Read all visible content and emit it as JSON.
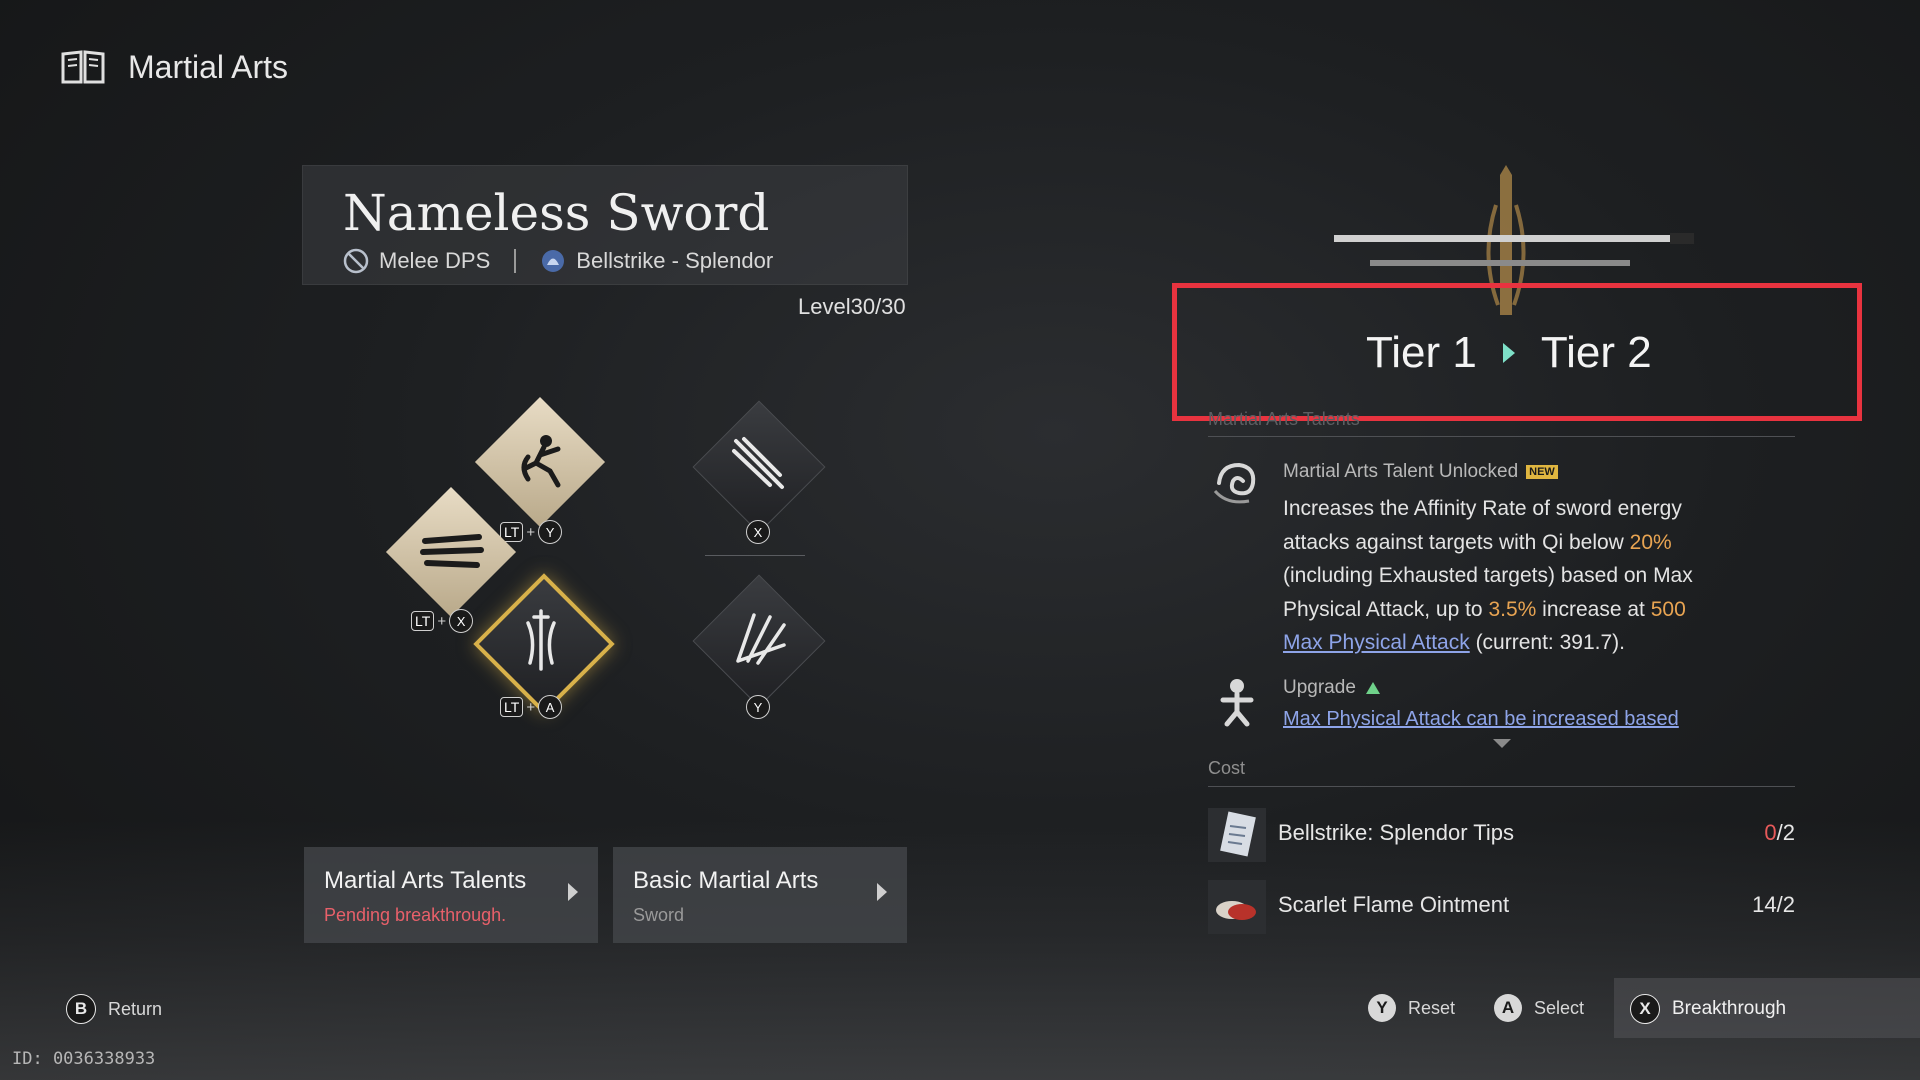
{
  "header": {
    "title": "Martial Arts",
    "icon": "book-icon"
  },
  "weapon": {
    "name": "Nameless Sword",
    "role_icon": "slash-circle-icon",
    "role": "Melee DPS",
    "path_icon": "bell-icon",
    "path": "Bellstrike - Splendor",
    "level_text": "Level30/30"
  },
  "skills": [
    {
      "icon": "kick-figure-icon",
      "hint": [
        "LT",
        "+",
        "Y"
      ]
    },
    {
      "icon": "triple-slash-icon",
      "hint": [
        "LT",
        "+",
        "X"
      ]
    },
    {
      "icon": "sword-spirit-icon",
      "hint": [
        "LT",
        "+",
        "A"
      ],
      "selected": true
    },
    {
      "icon": "sword-strike-icon",
      "hint": [
        "X"
      ]
    },
    {
      "icon": "claw-slash-icon",
      "hint": [
        "Y"
      ]
    }
  ],
  "tabs": [
    {
      "title": "Martial Arts Talents",
      "subtitle": "Pending breakthrough.",
      "subtitle_color": "#e8606a"
    },
    {
      "title": "Basic Martial Arts",
      "subtitle": "Sword",
      "subtitle_color": "#9a9a9a"
    }
  ],
  "tier": {
    "from": "Tier 1",
    "to": "Tier 2",
    "highlight_color": "#e8333f"
  },
  "talents_section": {
    "label": "Martial Arts Talents"
  },
  "talent": {
    "icon": "swirl-icon",
    "heading": "Martial Arts Talent Unlocked",
    "badge": "NEW",
    "text_1": "Increases the Affinity Rate of sword energy attacks against targets with Qi below ",
    "qi_threshold": "20%",
    "text_2": " (including Exhausted targets) based on Max Physical Attack, up to ",
    "max_increase": "3.5%",
    "text_3": " increase at ",
    "attack_cap": "500",
    "link": "Max Physical Attack",
    "text_4": " (current: 391.7)."
  },
  "upgrade": {
    "icon": "figure-icon",
    "heading": "Upgrade",
    "text": "Max Physical Attack can be increased based"
  },
  "cost": {
    "label": "Cost",
    "items": [
      {
        "icon": "scroll-icon",
        "name": "Bellstrike: Splendor Tips",
        "have": "0",
        "need": "2"
      },
      {
        "icon": "ointment-icon",
        "name": "Scarlet Flame Ointment",
        "qty": "14/2"
      }
    ]
  },
  "footer": {
    "return_key": "B",
    "return_label": "Return",
    "reset_key": "Y",
    "reset_label": "Reset",
    "select_key": "A",
    "select_label": "Select",
    "breakthrough_key": "X",
    "breakthrough_label": "Breakthrough"
  },
  "id_text": "ID: 0036338933"
}
